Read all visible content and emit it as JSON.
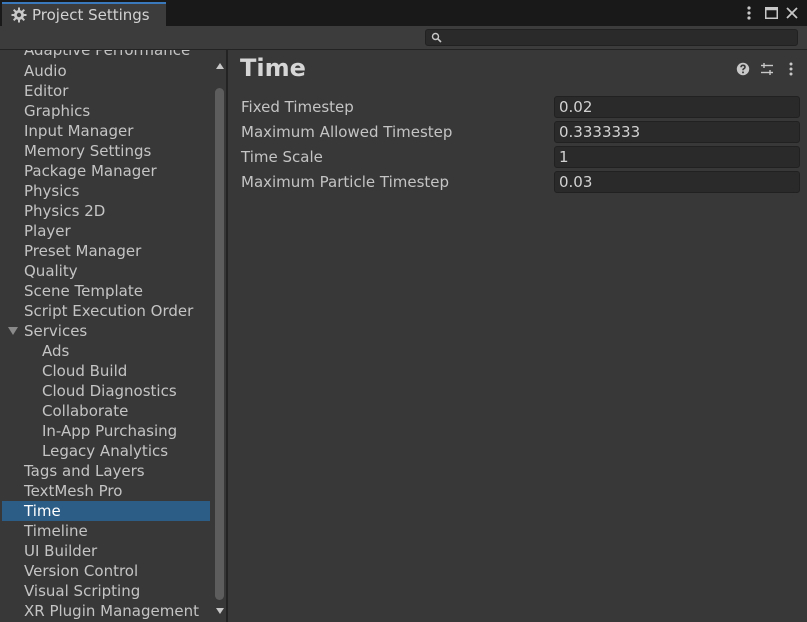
{
  "window": {
    "tab_title": "Project Settings"
  },
  "search": {
    "value": "",
    "placeholder": ""
  },
  "sidebar": {
    "partial_top_item": "Adaptive Performance",
    "items": [
      {
        "label": "Audio"
      },
      {
        "label": "Editor"
      },
      {
        "label": "Graphics"
      },
      {
        "label": "Input Manager"
      },
      {
        "label": "Memory Settings"
      },
      {
        "label": "Package Manager"
      },
      {
        "label": "Physics"
      },
      {
        "label": "Physics 2D"
      },
      {
        "label": "Player"
      },
      {
        "label": "Preset Manager"
      },
      {
        "label": "Quality"
      },
      {
        "label": "Scene Template"
      },
      {
        "label": "Script Execution Order"
      },
      {
        "label": "Services",
        "expanded": true
      },
      {
        "label": "Ads",
        "child": true
      },
      {
        "label": "Cloud Build",
        "child": true
      },
      {
        "label": "Cloud Diagnostics",
        "child": true
      },
      {
        "label": "Collaborate",
        "child": true
      },
      {
        "label": "In-App Purchasing",
        "child": true
      },
      {
        "label": "Legacy Analytics",
        "child": true
      },
      {
        "label": "Tags and Layers"
      },
      {
        "label": "TextMesh Pro"
      },
      {
        "label": "Time",
        "selected": true
      },
      {
        "label": "Timeline"
      },
      {
        "label": "UI Builder"
      },
      {
        "label": "Version Control"
      },
      {
        "label": "Visual Scripting"
      },
      {
        "label": "XR Plugin Management"
      }
    ]
  },
  "main": {
    "title": "Time",
    "properties": [
      {
        "label": "Fixed Timestep",
        "value": "0.02"
      },
      {
        "label": "Maximum Allowed Timestep",
        "value": "0.3333333"
      },
      {
        "label": "Time Scale",
        "value": "1"
      },
      {
        "label": "Maximum Particle Timestep",
        "value": "0.03"
      }
    ]
  },
  "icons": {
    "tab": "gear-icon",
    "window_controls": [
      "more-vertical-icon",
      "maximize-icon",
      "close-icon"
    ],
    "header": [
      "help-icon",
      "preset-sliders-icon",
      "more-vertical-icon"
    ],
    "search": "search-icon"
  },
  "colors": {
    "selection": "#2c5d87",
    "tab_accent": "#3a79bb",
    "background": "#383838"
  }
}
